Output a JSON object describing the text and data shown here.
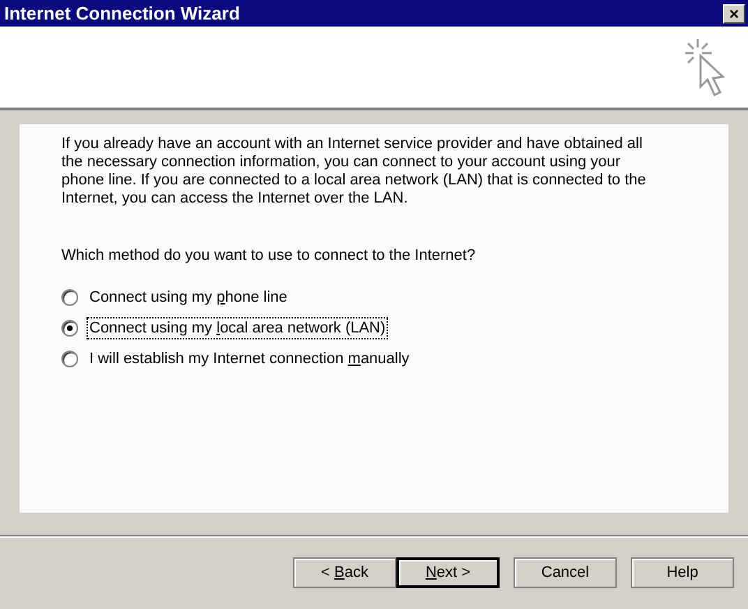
{
  "window": {
    "title": "Internet Connection Wizard",
    "close": "×"
  },
  "intro": "If you already have an account with an Internet service provider and have obtained all the necessary connection information, you can connect to your account using your phone line. If you are connected to a local area network (LAN) that is connected to the Internet, you can access the Internet over the LAN.",
  "question": "Which method do you want to use to connect to the Internet?",
  "options": [
    {
      "label_parts": [
        {
          "text": "Connect using my ",
          "underline": false
        },
        {
          "text": "p",
          "underline": true
        },
        {
          "text": "hone line",
          "underline": false
        }
      ],
      "selected": false
    },
    {
      "label_parts": [
        {
          "text": "Connect using my ",
          "underline": false
        },
        {
          "text": "l",
          "underline": true
        },
        {
          "text": "ocal area network (LAN)",
          "underline": false
        }
      ],
      "selected": true
    },
    {
      "label_parts": [
        {
          "text": "I will establish my Internet connection ",
          "underline": false
        },
        {
          "text": "m",
          "underline": true
        },
        {
          "text": "anually",
          "underline": false
        }
      ],
      "selected": false
    }
  ],
  "buttons": [
    {
      "label_parts": [
        {
          "text": "< ",
          "underline": false
        },
        {
          "text": "B",
          "underline": true
        },
        {
          "text": "ack",
          "underline": false
        }
      ],
      "default": false
    },
    {
      "label_parts": [
        {
          "text": "N",
          "underline": true
        },
        {
          "text": "ext >",
          "underline": false
        }
      ],
      "default": true
    },
    {
      "label_parts": [
        {
          "text": "Cancel",
          "underline": false
        }
      ],
      "default": false
    },
    {
      "label_parts": [
        {
          "text": "Help",
          "underline": false
        }
      ],
      "default": false
    }
  ]
}
